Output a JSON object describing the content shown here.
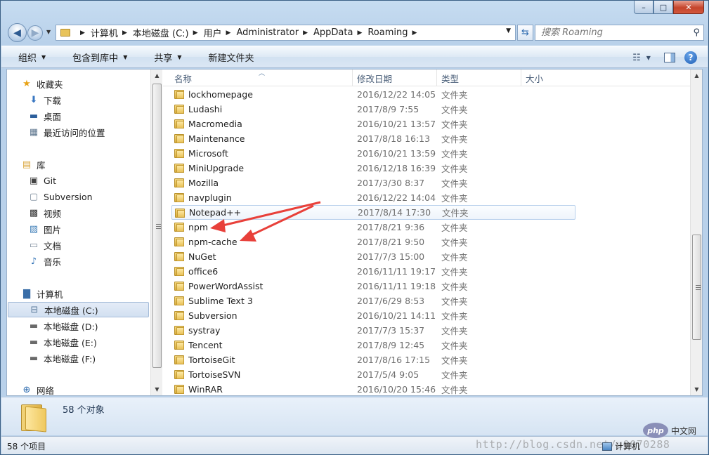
{
  "window": {
    "controls": {
      "minimize": "–",
      "maximize": "□",
      "close": "✕"
    }
  },
  "address": {
    "crumbs": [
      "计算机",
      "本地磁盘 (C:)",
      "用户",
      "Administrator",
      "AppData",
      "Roaming"
    ],
    "search_placeholder": "搜索 Roaming"
  },
  "toolbar": {
    "organize": "组织",
    "include_in_library": "包含到库中",
    "share": "共享",
    "new_folder": "新建文件夹"
  },
  "nav": {
    "favorites": {
      "label": "收藏夹",
      "items": [
        "下载",
        "桌面",
        "最近访问的位置"
      ]
    },
    "libraries": {
      "label": "库",
      "items": [
        "Git",
        "Subversion",
        "视频",
        "图片",
        "文档",
        "音乐"
      ]
    },
    "computer": {
      "label": "计算机",
      "items": [
        "本地磁盘 (C:)",
        "本地磁盘 (D:)",
        "本地磁盘 (E:)",
        "本地磁盘 (F:)"
      ]
    },
    "network": {
      "label": "网络"
    }
  },
  "columns": {
    "name": "名称",
    "date": "修改日期",
    "type": "类型",
    "size": "大小"
  },
  "files": [
    {
      "name": "lockhomepage",
      "date": "2016/12/22 14:05",
      "type": "文件夹"
    },
    {
      "name": "Ludashi",
      "date": "2017/8/9 7:55",
      "type": "文件夹"
    },
    {
      "name": "Macromedia",
      "date": "2016/10/21 13:57",
      "type": "文件夹"
    },
    {
      "name": "Maintenance",
      "date": "2017/8/18 16:13",
      "type": "文件夹"
    },
    {
      "name": "Microsoft",
      "date": "2016/10/21 13:59",
      "type": "文件夹"
    },
    {
      "name": "MiniUpgrade",
      "date": "2016/12/18 16:39",
      "type": "文件夹"
    },
    {
      "name": "Mozilla",
      "date": "2017/3/30 8:37",
      "type": "文件夹"
    },
    {
      "name": "navplugin",
      "date": "2016/12/22 14:04",
      "type": "文件夹"
    },
    {
      "name": "Notepad++",
      "date": "2017/8/14 17:30",
      "type": "文件夹"
    },
    {
      "name": "npm",
      "date": "2017/8/21 9:36",
      "type": "文件夹"
    },
    {
      "name": "npm-cache",
      "date": "2017/8/21 9:50",
      "type": "文件夹"
    },
    {
      "name": "NuGet",
      "date": "2017/7/3 15:00",
      "type": "文件夹"
    },
    {
      "name": "office6",
      "date": "2016/11/11 19:17",
      "type": "文件夹"
    },
    {
      "name": "PowerWordAssist",
      "date": "2016/11/11 19:18",
      "type": "文件夹"
    },
    {
      "name": "Sublime Text 3",
      "date": "2017/6/29 8:53",
      "type": "文件夹"
    },
    {
      "name": "Subversion",
      "date": "2016/10/21 14:11",
      "type": "文件夹"
    },
    {
      "name": "systray",
      "date": "2017/7/3 15:37",
      "type": "文件夹"
    },
    {
      "name": "Tencent",
      "date": "2017/8/9 12:45",
      "type": "文件夹"
    },
    {
      "name": "TortoiseGit",
      "date": "2017/8/16 17:15",
      "type": "文件夹"
    },
    {
      "name": "TortoiseSVN",
      "date": "2017/5/4 9:05",
      "type": "文件夹"
    },
    {
      "name": "WinRAR",
      "date": "2016/10/20 15:46",
      "type": "文件夹"
    }
  ],
  "hover_row": "Notepad++",
  "details": {
    "count": "58 个对象"
  },
  "status": {
    "items": "58 个项目",
    "location": "计算机",
    "watermark": "http://blog.csdn.net/u0070288"
  },
  "logo": {
    "badge": "php",
    "text": "中文网"
  },
  "colors": {
    "annotation_arrow": "#e8403a",
    "folder": "#e9c25a",
    "chrome": "#b9d1ea"
  }
}
